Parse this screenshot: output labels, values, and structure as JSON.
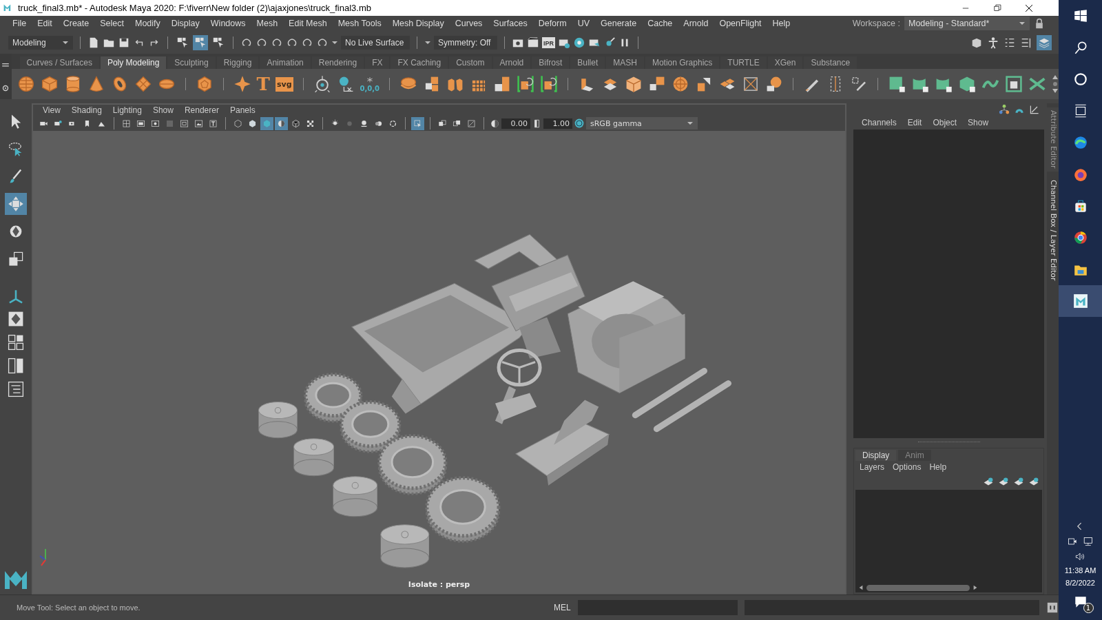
{
  "window": {
    "title": "truck_final3.mb* - Autodesk Maya 2020: F:\\fiverr\\New folder (2)\\ajaxjones\\truck_final3.mb"
  },
  "menu_bar": [
    "File",
    "Edit",
    "Create",
    "Select",
    "Modify",
    "Display",
    "Windows",
    "Mesh",
    "Edit Mesh",
    "Mesh Tools",
    "Mesh Display",
    "Curves",
    "Surfaces",
    "Deform",
    "UV",
    "Generate",
    "Cache",
    "Arnold",
    "OpenFlight",
    "Help"
  ],
  "workspace": {
    "label": "Workspace :",
    "value": "Modeling - Standard*"
  },
  "status_line": {
    "menu_set": "Modeling",
    "select_modes": [
      {
        "on": false
      },
      {
        "on": true
      },
      {
        "on": false
      }
    ],
    "live_surface": "No Live Surface",
    "symmetry": "Symmetry: Off",
    "ipr_label": "IPR"
  },
  "shelf": {
    "tabs": [
      {
        "label": "Curves / Surfaces",
        "selected": false
      },
      {
        "label": "Poly Modeling",
        "selected": true
      },
      {
        "label": "Sculpting",
        "selected": false
      },
      {
        "label": "Rigging",
        "selected": false
      },
      {
        "label": "Animation",
        "selected": false
      },
      {
        "label": "Rendering",
        "selected": false
      },
      {
        "label": "FX",
        "selected": false
      },
      {
        "label": "FX Caching",
        "selected": false
      },
      {
        "label": "Custom",
        "selected": false
      },
      {
        "label": "Arnold",
        "selected": false
      },
      {
        "label": "Bifrost",
        "selected": false
      },
      {
        "label": "Bullet",
        "selected": false
      },
      {
        "label": "MASH",
        "selected": false
      },
      {
        "label": "Motion Graphics",
        "selected": false
      },
      {
        "label": "TURTLE",
        "selected": false
      },
      {
        "label": "XGen",
        "selected": false
      },
      {
        "label": "Substance",
        "selected": false
      }
    ],
    "text_icons": [
      "T",
      "svg"
    ],
    "snap_label": "0,0,0"
  },
  "tools": [
    {
      "selected": false
    },
    {
      "selected": false
    },
    {
      "selected": false
    },
    {
      "selected": true
    },
    {
      "selected": false
    },
    {
      "selected": false
    }
  ],
  "viewport": {
    "menus": [
      "View",
      "Shading",
      "Lighting",
      "Show",
      "Renderer",
      "Panels"
    ],
    "toggles": [
      {
        "on": false
      },
      {
        "on": false
      },
      {
        "on": false
      },
      {
        "on": false
      },
      {
        "on": false
      },
      {
        "on": false
      },
      {
        "on": false
      },
      {
        "on": false
      },
      {
        "on": false
      },
      {
        "on": false
      },
      {
        "on": false
      },
      {
        "on": false
      },
      {
        "on": false
      },
      {
        "on": false
      },
      {
        "on": true
      },
      {
        "on": true
      },
      {
        "on": false
      },
      {
        "on": false
      },
      {
        "on": false
      },
      {
        "on": false
      },
      {
        "on": false
      },
      {
        "on": false
      },
      {
        "on": false
      },
      {
        "on": true
      },
      {
        "on": false
      },
      {
        "on": false
      },
      {
        "on": false
      }
    ],
    "exposure": "0.00",
    "gamma": "1.00",
    "color_space": "sRGB gamma",
    "camera_label": "Isolate : persp"
  },
  "channel_box": {
    "menus": [
      "Channels",
      "Edit",
      "Object",
      "Show"
    ]
  },
  "side_tabs": [
    "Attribute Editor",
    "Channel Box / Layer Editor"
  ],
  "layer_editor": {
    "tabs": [
      {
        "label": "Display",
        "selected": true
      },
      {
        "label": "Anim",
        "selected": false
      }
    ],
    "menus": [
      "Layers",
      "Options",
      "Help"
    ]
  },
  "help_line": "Move Tool: Select an object to move.",
  "command_line": {
    "language": "MEL"
  },
  "taskbar": {
    "time": "11:38 AM",
    "date": "8/2/2022",
    "notification_count": "1"
  }
}
